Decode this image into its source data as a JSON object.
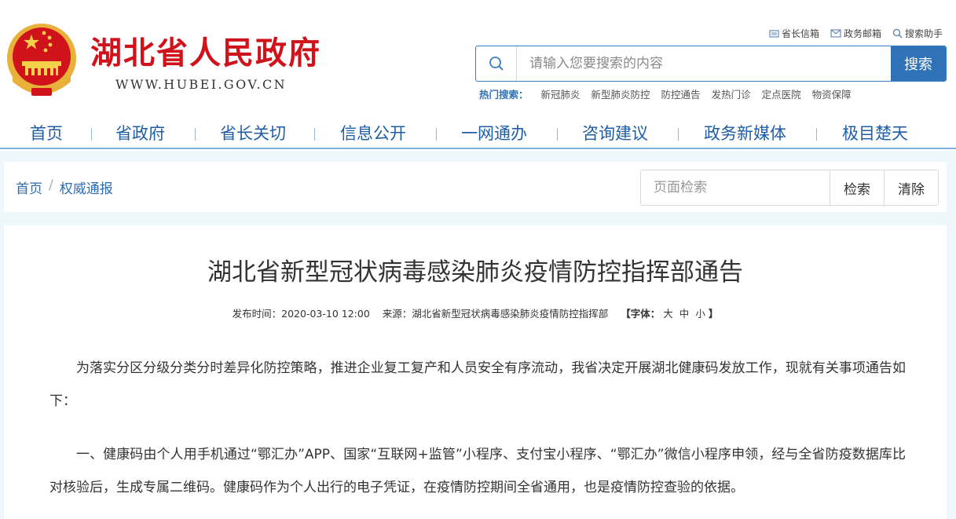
{
  "header": {
    "site_title": "湖北省人民政府",
    "site_url": "WWW.HUBEI.GOV.CN",
    "top_links": [
      "省长信箱",
      "政务邮箱",
      "搜索助手"
    ],
    "search": {
      "placeholder": "请输入您要搜索的内容",
      "button": "搜索"
    },
    "hot_label": "热门搜索：",
    "hot_words": [
      "新冠肺炎",
      "新型肺炎防控",
      "防控通告",
      "发热门诊",
      "定点医院",
      "物资保障"
    ]
  },
  "nav": [
    "首页",
    "省政府",
    "省长关切",
    "信息公开",
    "一网通办",
    "咨询建议",
    "政务新媒体",
    "极目楚天"
  ],
  "breadcrumb": {
    "home": "首页",
    "sep": "/",
    "current": "权威通报"
  },
  "page_search": {
    "placeholder": "页面检索",
    "search_button": "检索",
    "clear_button": "清除"
  },
  "article": {
    "title": "湖北省新型冠状病毒感染肺炎疫情防控指挥部通告",
    "published": "发布时间：2020-03-10 12:00",
    "source": "来源：湖北省新型冠状病毒感染肺炎疫情防控指挥部",
    "font_label_open": "【字体：",
    "font_sizes": [
      "大",
      "中",
      "小"
    ],
    "font_label_close": "】",
    "paragraphs": [
      "为落实分区分级分类分时差异化防控策略，推进企业复工复产和人员安全有序流动，我省决定开展湖北健康码发放工作，现就有关事项通告如下：",
      "一、健康码由个人用手机通过“鄂汇办”APP、国家“互联网+监管”小程序、支付宝小程序、“鄂汇办”微信小程序申领，经与全省防疫数据库比对核验后，生成专属二维码。健康码作为个人出行的电子凭证，在疫情防控期间全省通用，也是疫情防控查验的依据。"
    ]
  },
  "colors": {
    "brand_red": "#d0121b",
    "nav_blue": "#1f5ea5",
    "search_blue": "#2f72b8",
    "page_bg": "#eef7fc"
  }
}
